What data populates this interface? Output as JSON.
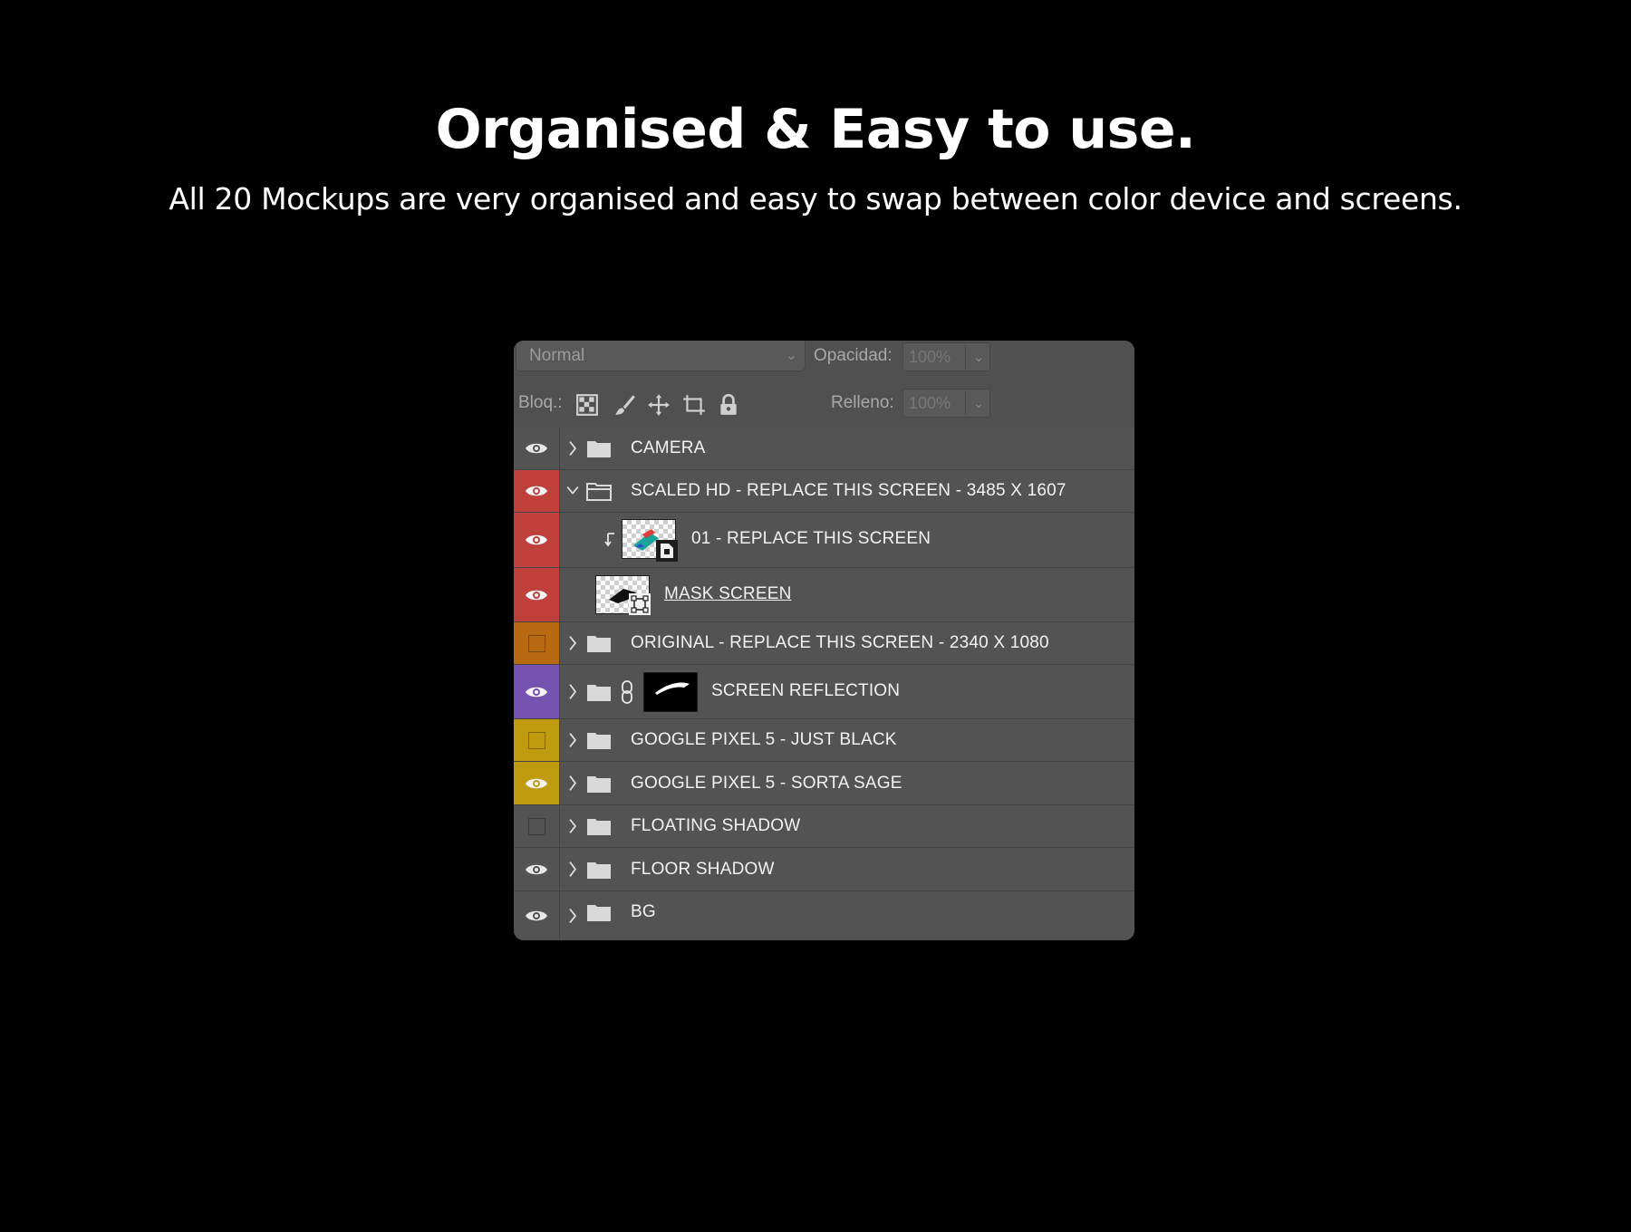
{
  "headline": "Organised & Easy to use.",
  "subline": "All 20 Mockups are very organised and easy to swap between color device and screens.",
  "panel": {
    "blend_mode": "Normal",
    "opacity_label": "Opacidad:",
    "opacity_value": "100%",
    "lock_label": "Bloq.:",
    "fill_label": "Relleno:",
    "fill_value": "100%",
    "lock_icons": [
      "lock-transparent-pixels-icon",
      "lock-image-pixels-icon",
      "lock-position-icon",
      "lock-artboard-icon",
      "lock-all-icon"
    ]
  },
  "layers": [
    {
      "name": "CAMERA",
      "visible": true,
      "color": "#535353",
      "type": "group",
      "expanded": false
    },
    {
      "name": "SCALED HD - REPLACE THIS SCREEN - 3485 X 1607",
      "visible": true,
      "color": "#c0403c",
      "type": "group",
      "expanded": true
    },
    {
      "name": "01 - REPLACE THIS SCREEN",
      "visible": true,
      "color": "#c0403c",
      "type": "smart-object",
      "clipped": true
    },
    {
      "name": "MASK SCREEN",
      "visible": true,
      "color": "#c0403c",
      "type": "shape"
    },
    {
      "name": "ORIGINAL - REPLACE THIS SCREEN - 2340 X 1080",
      "visible": false,
      "color": "#b86a12",
      "type": "group",
      "expanded": false
    },
    {
      "name": "SCREEN REFLECTION",
      "visible": true,
      "color": "#7652b0",
      "type": "group-with-mask",
      "expanded": false
    },
    {
      "name": "GOOGLE PIXEL 5 - JUST BLACK",
      "visible": false,
      "color": "#c09b10",
      "type": "group",
      "expanded": false
    },
    {
      "name": "GOOGLE PIXEL 5 - SORTA SAGE",
      "visible": true,
      "color": "#c09b10",
      "type": "group",
      "expanded": false
    },
    {
      "name": "FLOATING SHADOW",
      "visible": false,
      "color": "#535353",
      "type": "group",
      "expanded": false
    },
    {
      "name": "FLOOR SHADOW",
      "visible": true,
      "color": "#535353",
      "type": "group",
      "expanded": false
    },
    {
      "name": "BG",
      "visible": true,
      "color": "#535353",
      "type": "group",
      "expanded": false
    }
  ]
}
